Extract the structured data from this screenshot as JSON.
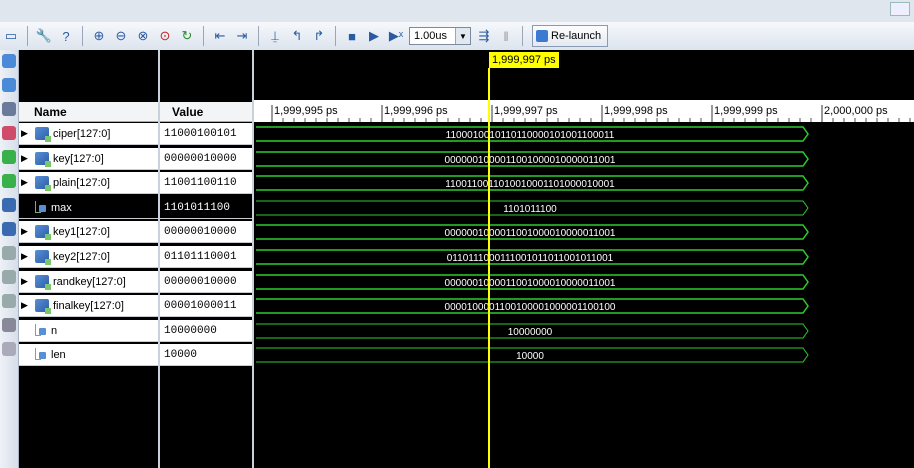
{
  "toolbar": {
    "time_unit": "1.00us",
    "relaunch_label": "Re-launch"
  },
  "columns": {
    "name": "Name",
    "value": "Value"
  },
  "cursor": {
    "label": "1,999,997 ps"
  },
  "ruler": {
    "ticks": [
      "1,999,995 ps",
      "1,999,996 ps",
      "1,999,997 ps",
      "1,999,998 ps",
      "1,999,999 ps",
      "2,000,000 ps"
    ]
  },
  "signals": [
    {
      "name": "ciper[127:0]",
      "value": "11000100101",
      "wave": "1100010010110110000101001100011",
      "bus": true
    },
    {
      "name": "key[127:0]",
      "value": "00000010000",
      "wave": "0000001000011001000010000011001",
      "bus": true
    },
    {
      "name": "plain[127:0]",
      "value": "11001100110",
      "wave": "1100110011010010001101000010001",
      "bus": true
    },
    {
      "name": "max",
      "value": "1101011100",
      "wave": "1101011100",
      "bus": false,
      "selected": true
    },
    {
      "name": "key1[127:0]",
      "value": "00000010000",
      "wave": "0000001000011001000010000011001",
      "bus": true
    },
    {
      "name": "key2[127:0]",
      "value": "01101110001",
      "wave": "0110111000111001011011001011001",
      "bus": true
    },
    {
      "name": "randkey[127:0]",
      "value": "00000010000",
      "wave": "0000001000011001000010000011001",
      "bus": true
    },
    {
      "name": "finalkey[127:0]",
      "value": "00001000011",
      "wave": "0000100001100100001000001100100",
      "bus": true
    },
    {
      "name": "n",
      "value": "10000000",
      "wave": "10000000",
      "bus": false
    },
    {
      "name": "len",
      "value": "10000",
      "wave": "10000",
      "bus": false
    }
  ],
  "colors": {
    "wave": "#2ecc2e",
    "cursor": "#ffff00",
    "background": "#000000"
  }
}
